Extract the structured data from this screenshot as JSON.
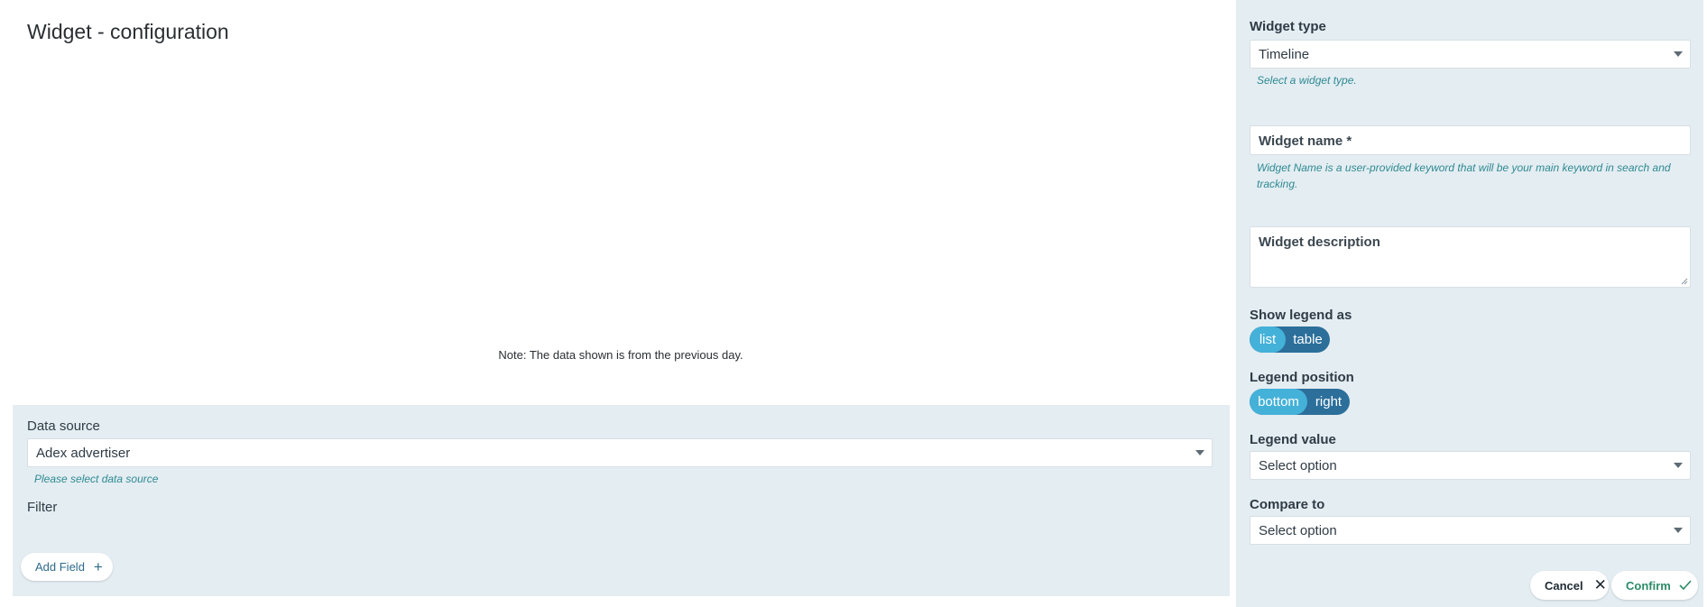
{
  "page": {
    "title": "Widget - configuration"
  },
  "preview": {
    "note": "Note: The data shown is from the previous day."
  },
  "data_source": {
    "label": "Data source",
    "value": "Adex advertiser",
    "hint": "Please select data source",
    "filter_label": "Filter",
    "add_field_label": "Add Field"
  },
  "settings": {
    "widget_type": {
      "label": "Widget type",
      "value": "Timeline",
      "hint": "Select a widget type."
    },
    "widget_name": {
      "placeholder": "Widget name *",
      "hint": "Widget Name is a user-provided keyword that will be your main keyword in search and tracking."
    },
    "widget_description": {
      "placeholder": "Widget description"
    },
    "show_legend_as": {
      "label": "Show legend as",
      "options": [
        "list",
        "table"
      ],
      "selected": "list"
    },
    "legend_position": {
      "label": "Legend position",
      "options": [
        "bottom",
        "right"
      ],
      "selected": "bottom"
    },
    "legend_value": {
      "label": "Legend value",
      "value": "Select option"
    },
    "compare_to": {
      "label": "Compare to",
      "value": "Select option"
    }
  },
  "actions": {
    "cancel_label": "Cancel",
    "confirm_label": "Confirm"
  },
  "colors": {
    "panel_bg": "#e4edf2",
    "toggle_dark": "#2c6f9b",
    "toggle_active": "#44b1d8",
    "hint": "#2e8a92",
    "confirm": "#2c8b68"
  }
}
